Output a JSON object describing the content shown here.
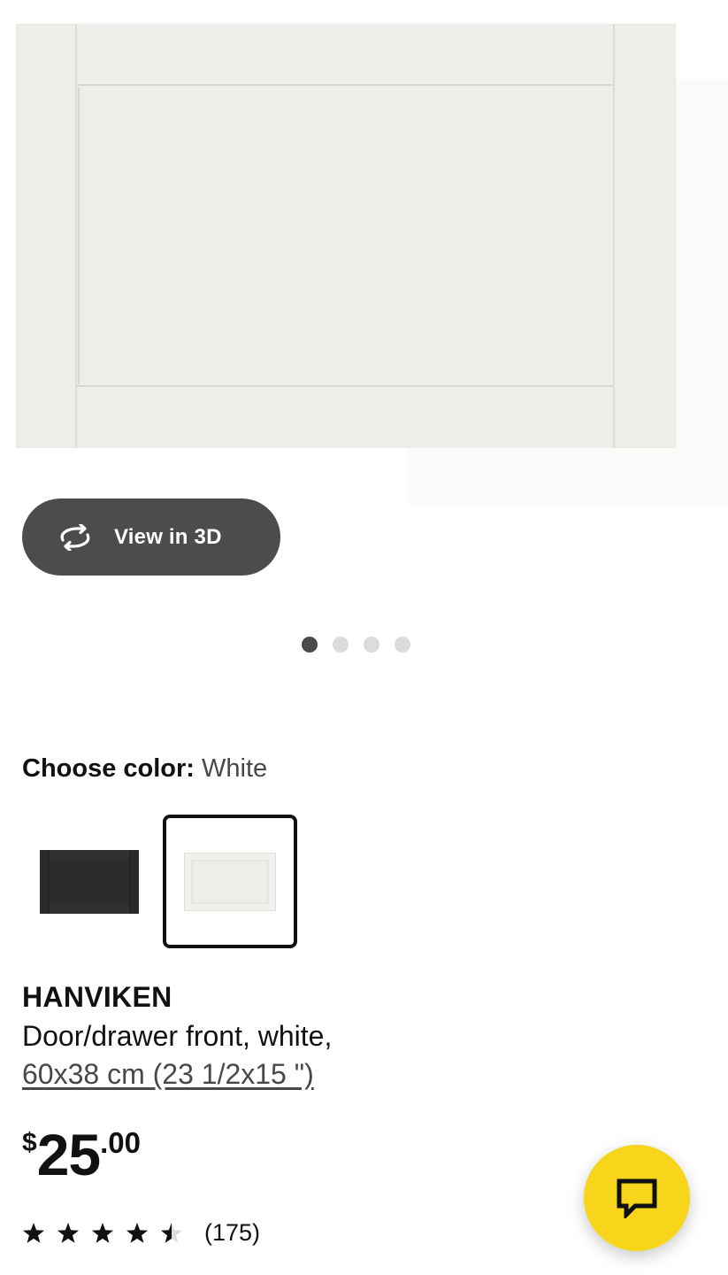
{
  "gallery": {
    "view_3d_label": "View in 3D",
    "slide_count": 4,
    "active_slide": 1
  },
  "color": {
    "label": "Choose color:",
    "selected": "White",
    "options": [
      "black",
      "white"
    ]
  },
  "product": {
    "name": "HANVIKEN",
    "description": "Door/drawer front, white,",
    "size": "60x38 cm (23 1/2x15 \")"
  },
  "price": {
    "currency": "$",
    "integer": "25",
    "decimal": ".00"
  },
  "rating": {
    "stars": 4.5,
    "max": 5,
    "count": "(175)"
  },
  "icons": {
    "view3d": "rotate-3d-icon",
    "chat": "chat-bubble-icon",
    "star": "star-icon"
  },
  "colors": {
    "button_dark": "#4c4c4c",
    "chat_yellow": "#f6d51a",
    "text": "#111111",
    "muted": "#484848"
  }
}
